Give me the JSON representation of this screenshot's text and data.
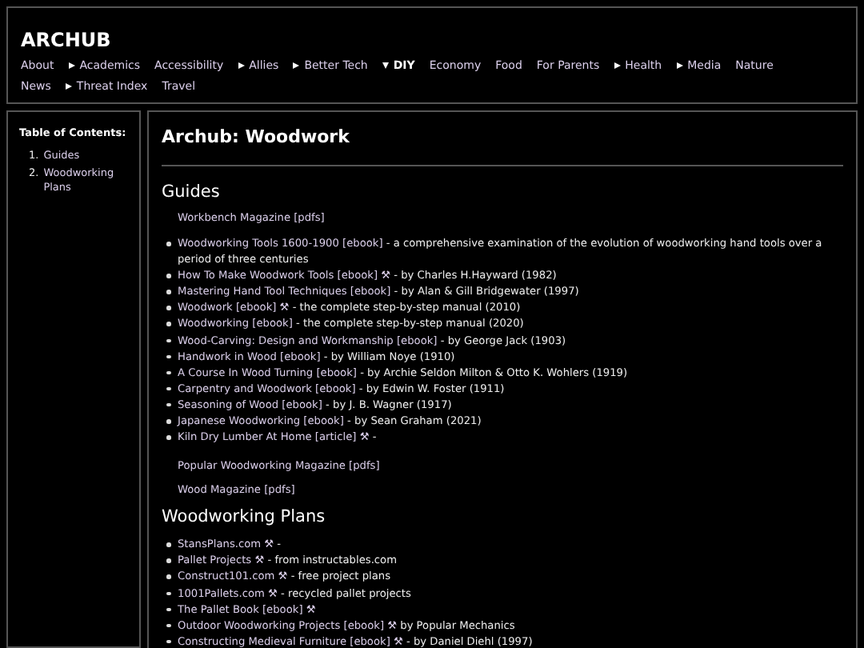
{
  "site": {
    "title": "ARCHUB"
  },
  "nav": [
    {
      "label": "About",
      "kind": "link",
      "expanded": false
    },
    {
      "label": "Academics",
      "kind": "menu",
      "expanded": false
    },
    {
      "label": "Accessibility",
      "kind": "link",
      "expanded": false
    },
    {
      "label": "Allies",
      "kind": "menu",
      "expanded": false
    },
    {
      "label": "Better Tech",
      "kind": "menu",
      "expanded": false
    },
    {
      "label": "DIY",
      "kind": "menu",
      "expanded": true
    },
    {
      "label": "Economy",
      "kind": "link",
      "expanded": false
    },
    {
      "label": "Food",
      "kind": "link",
      "expanded": false
    },
    {
      "label": "For Parents",
      "kind": "link",
      "expanded": false
    },
    {
      "label": "Health",
      "kind": "menu",
      "expanded": false
    },
    {
      "label": "Media",
      "kind": "menu",
      "expanded": false
    },
    {
      "label": "Nature",
      "kind": "link",
      "expanded": false
    },
    {
      "label": "News",
      "kind": "link",
      "expanded": false
    },
    {
      "label": "Threat Index",
      "kind": "menu",
      "expanded": false
    },
    {
      "label": "Travel",
      "kind": "link",
      "expanded": false
    }
  ],
  "toc": {
    "title": "Table of Contents:",
    "items": [
      {
        "number": "1.",
        "label": "Guides"
      },
      {
        "number": "2.",
        "label": "Woodworking Plans"
      }
    ]
  },
  "page": {
    "title": "Archub: Woodwork",
    "sections": [
      {
        "heading": "Guides",
        "blocks": [
          {
            "kind": "link",
            "link": "Workbench Magazine [pdfs]"
          },
          {
            "kind": "list",
            "items": [
              {
                "link": "Woodworking Tools 1600-1900 [ebook]",
                "rest": " - a comprehensive examination of the evolution of woodworking hand tools over a period of three centuries"
              },
              {
                "link": "How To Make Woodwork Tools [ebook] ⚒",
                "rest": " - by Charles H.Hayward (1982)"
              },
              {
                "link": "Mastering Hand Tool Techniques [ebook]",
                "rest": " - by Alan & Gill Bridgewater (1997)"
              },
              {
                "link": "Woodwork [ebook] ⚒",
                "rest": " - the complete step-by-step manual (2010)"
              },
              {
                "link": "Woodworking [ebook]",
                "rest": " - the complete step-by-step manual (2020)"
              },
              {
                "link": "Wood-Carving: Design and Workmanship [ebook]",
                "rest": " - by George Jack (1903)"
              },
              {
                "link": "Handwork in Wood [ebook]",
                "rest": " - by William Noye (1910)"
              },
              {
                "link": "A Course In Wood Turning [ebook]",
                "rest": " - by Archie Seldon Milton & Otto K. Wohlers (1919)"
              },
              {
                "link": "Carpentry and Woodwork [ebook]",
                "rest": " - by Edwin W. Foster (1911)"
              },
              {
                "link": "Seasoning of Wood [ebook]",
                "rest": " - by J. B. Wagner (1917)"
              },
              {
                "link": "Japanese Woodworking [ebook]",
                "rest": " - by Sean Graham (2021)"
              },
              {
                "link": "Kiln Dry Lumber At Home [article] ⚒",
                "rest": " -"
              }
            ]
          },
          {
            "kind": "link",
            "link": "Popular Woodworking Magazine [pdfs]"
          },
          {
            "kind": "link",
            "link": "Wood Magazine [pdfs]"
          }
        ]
      },
      {
        "heading": "Woodworking Plans",
        "blocks": [
          {
            "kind": "list",
            "items": [
              {
                "link": "StansPlans.com ⚒",
                "rest": " -"
              },
              {
                "link": "Pallet Projects ⚒",
                "rest": " - from instructables.com"
              },
              {
                "link": "Construct101.com ⚒",
                "rest": " - free project plans"
              },
              {
                "link": "1001Pallets.com ⚒",
                "rest": " - recycled pallet projects"
              },
              {
                "link": "The Pallet Book [ebook] ⚒"
              },
              {
                "link": "Outdoor Woodworking Projects [ebook] ⚒",
                "rest": " by Popular Mechanics"
              },
              {
                "link": "Constructing Medieval Furniture [ebook] ⚒",
                "rest": " - by Daniel Diehl (1997)"
              }
            ]
          }
        ]
      }
    ]
  }
}
